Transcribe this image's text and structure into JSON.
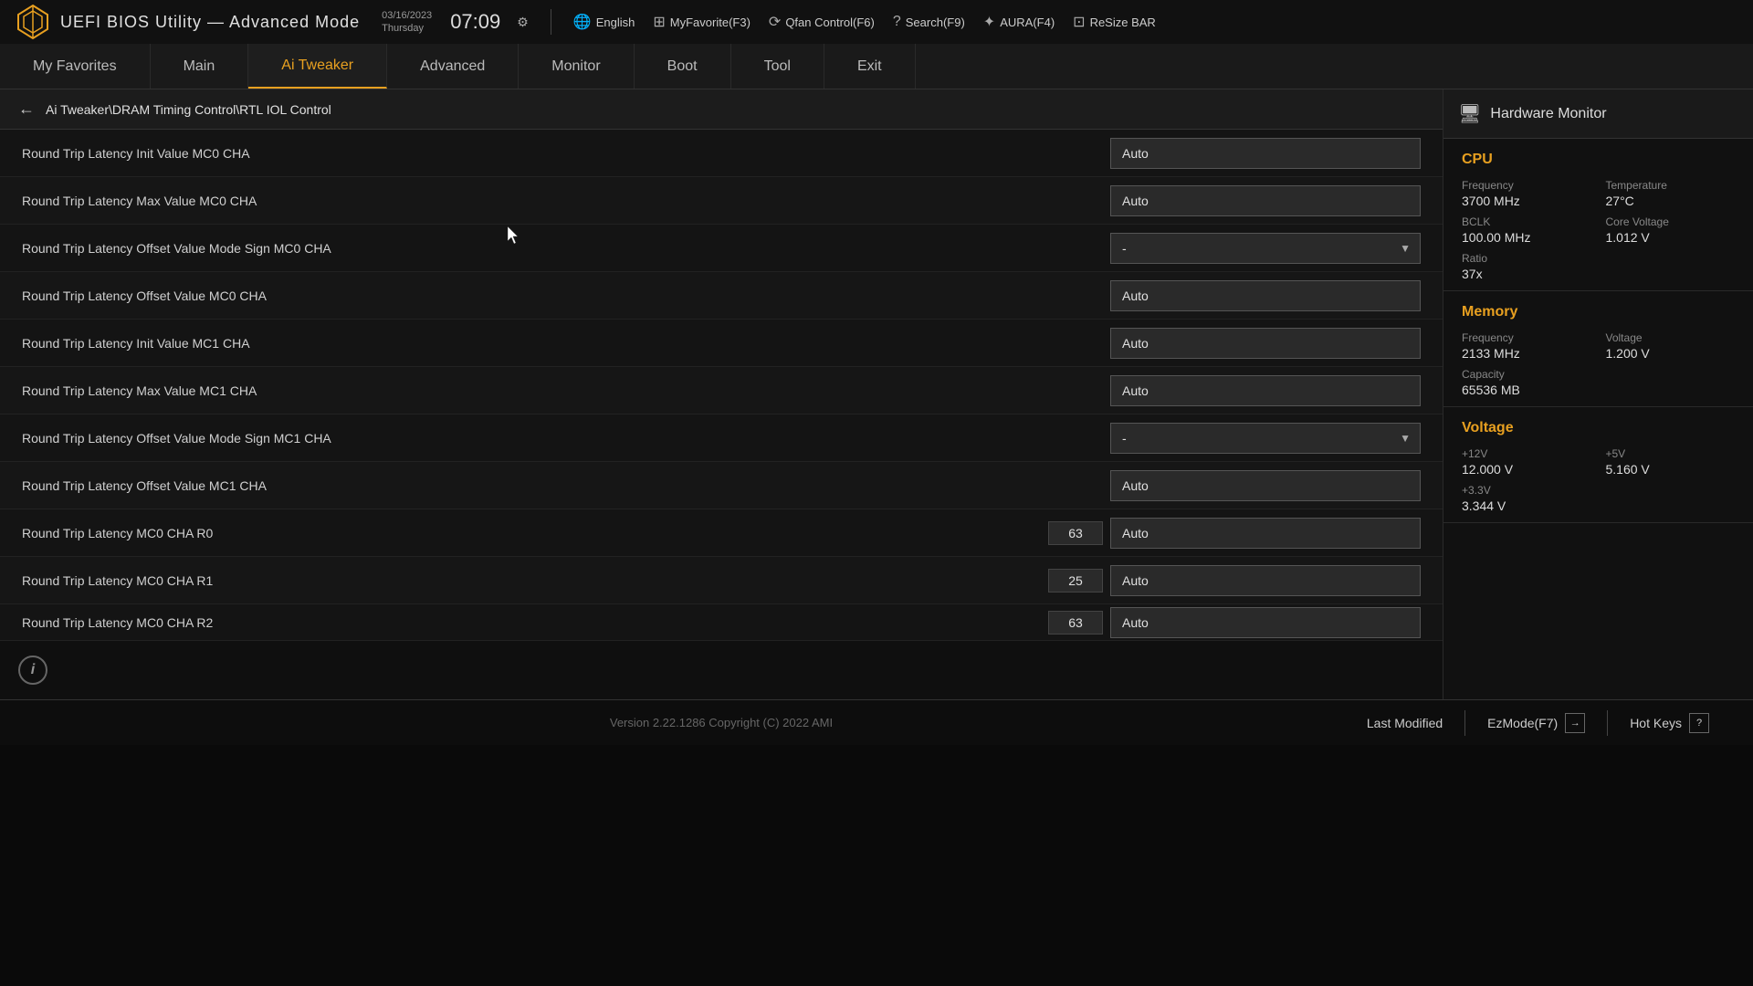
{
  "header": {
    "title": "UEFI BIOS Utility — Advanced Mode",
    "date": "03/16/2023",
    "day": "Thursday",
    "time": "07:09",
    "toolbar": {
      "language_label": "English",
      "myfavorite_label": "MyFavorite(F3)",
      "qfan_label": "Qfan Control(F6)",
      "search_label": "Search(F9)",
      "aura_label": "AURA(F4)",
      "resizerbar_label": "ReSize BAR"
    }
  },
  "nav": {
    "tabs": [
      {
        "label": "My Favorites",
        "active": false
      },
      {
        "label": "Main",
        "active": false
      },
      {
        "label": "Ai Tweaker",
        "active": true
      },
      {
        "label": "Advanced",
        "active": false
      },
      {
        "label": "Monitor",
        "active": false
      },
      {
        "label": "Boot",
        "active": false
      },
      {
        "label": "Tool",
        "active": false
      },
      {
        "label": "Exit",
        "active": false
      }
    ]
  },
  "breadcrumb": {
    "text": "Ai Tweaker\\DRAM Timing Control\\RTL IOL Control"
  },
  "settings": [
    {
      "label": "Round Trip Latency Init Value MC0 CHA",
      "type": "auto",
      "num": null
    },
    {
      "label": "Round Trip Latency Max Value MC0 CHA",
      "type": "auto",
      "num": null
    },
    {
      "label": "Round Trip Latency Offset Value Mode Sign MC0 CHA",
      "type": "dropdown",
      "value": "-",
      "num": null
    },
    {
      "label": "Round Trip Latency Offset Value MC0 CHA",
      "type": "auto",
      "num": null
    },
    {
      "label": "Round Trip Latency Init Value MC1 CHA",
      "type": "auto",
      "num": null
    },
    {
      "label": "Round Trip Latency Max Value MC1 CHA",
      "type": "auto",
      "num": null
    },
    {
      "label": "Round Trip Latency Offset Value Mode Sign MC1 CHA",
      "type": "dropdown",
      "value": "-",
      "num": null
    },
    {
      "label": "Round Trip Latency Offset Value MC1 CHA",
      "type": "auto",
      "num": null
    },
    {
      "label": "Round Trip Latency MC0 CHA R0",
      "type": "auto",
      "num": "63"
    },
    {
      "label": "Round Trip Latency MC0 CHA R1",
      "type": "auto",
      "num": "25"
    },
    {
      "label": "Round Trip Latency MC0 CHA R2",
      "type": "auto",
      "num": "63"
    }
  ],
  "hardware_monitor": {
    "title": "Hardware Monitor",
    "cpu": {
      "section_title": "CPU",
      "frequency_label": "Frequency",
      "frequency_value": "3700 MHz",
      "temperature_label": "Temperature",
      "temperature_value": "27°C",
      "bclk_label": "BCLK",
      "bclk_value": "100.00 MHz",
      "core_voltage_label": "Core Voltage",
      "core_voltage_value": "1.012 V",
      "ratio_label": "Ratio",
      "ratio_value": "37x"
    },
    "memory": {
      "section_title": "Memory",
      "frequency_label": "Frequency",
      "frequency_value": "2133 MHz",
      "voltage_label": "Voltage",
      "voltage_value": "1.200 V",
      "capacity_label": "Capacity",
      "capacity_value": "65536 MB"
    },
    "voltage": {
      "section_title": "Voltage",
      "v12_label": "+12V",
      "v12_value": "12.000 V",
      "v5_label": "+5V",
      "v5_value": "5.160 V",
      "v33_label": "+3.3V",
      "v33_value": "3.344 V"
    }
  },
  "footer": {
    "last_modified_label": "Last Modified",
    "ezmode_label": "EzMode(F7)",
    "hotkeys_label": "Hot Keys",
    "version_text": "Version 2.22.1286 Copyright (C) 2022 AMI"
  }
}
